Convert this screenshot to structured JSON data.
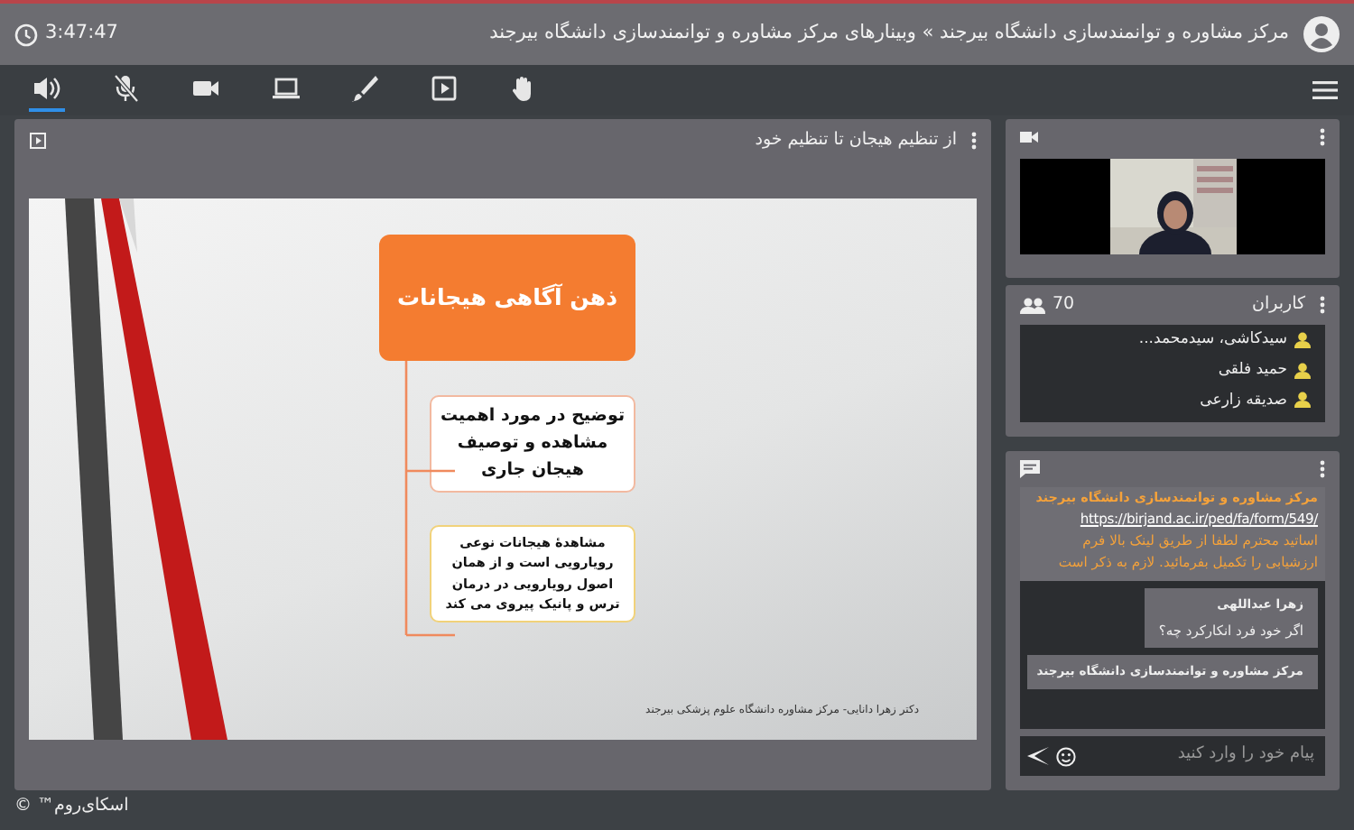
{
  "header": {
    "title": "مرکز مشاوره و توانمندسازی دانشگاه بیرجند » وبینارهای مرکز مشاوره و توانمندسازی دانشگاه بیرجند",
    "clock": "3:47:47"
  },
  "toolbar": [
    {
      "kind": "speaker",
      "selected": true
    },
    {
      "kind": "mic-off",
      "selected": false
    },
    {
      "kind": "camera",
      "selected": false
    },
    {
      "kind": "screen",
      "selected": false
    },
    {
      "kind": "brush",
      "selected": false
    },
    {
      "kind": "play",
      "selected": false
    },
    {
      "kind": "hand",
      "selected": false
    }
  ],
  "presentation": {
    "title": "از تنظیم هیجان تا تنظیم خود",
    "slide": {
      "heading": "ذهن آگاهی هیجانات",
      "boxes": [
        "توضیح در مورد اهمیت مشاهده و توصیف هیجان جاری",
        "مشاهدهٔ هیجانات نوعی رویارویی است و از همان اصول رویارویی در درمان ترس و پانیک پیروی می کند"
      ],
      "footer": "دکتر زهرا دانایی- مرکز مشاوره دانشگاه علوم پزشکی بیرجند"
    }
  },
  "users": {
    "title": "کاربران",
    "count": "70",
    "items": [
      "سیدکاشی، سیدمحمد...",
      "حمید فلقی",
      "صدیقه زارعی"
    ]
  },
  "chat": {
    "pinned": {
      "sender": "مرکز مشاوره و توانمندسازی دانشگاه بیرجند",
      "link": "https://birjand.ac.ir/ped/fa/form/549/",
      "text": "اساتید محترم لطفا از طریق لینک بالا فرم ارزشیابی را تکمیل بفرمائید. لازم به ذکر است"
    },
    "messages": [
      {
        "sender": "زهرا عبداللهی",
        "text": "اگر خود فرد انکارکرد چه؟"
      },
      {
        "sender": "مرکز مشاوره و توانمندسازی دانشگاه بیرجند"
      }
    ],
    "placeholder": "پیام خود را وارد کنید"
  },
  "footer": {
    "brand": "اسکای‌روم™ ©"
  }
}
